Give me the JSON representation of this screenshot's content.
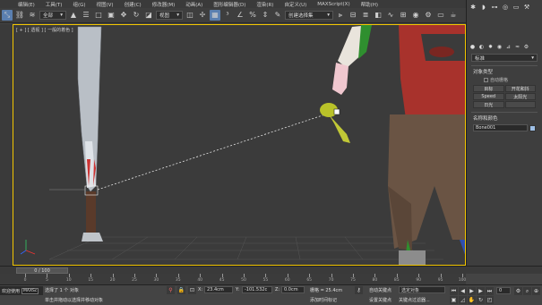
{
  "menu": {
    "items": [
      "编辑(E)",
      "工具(T)",
      "组(G)",
      "视图(V)",
      "创建(C)",
      "修改器(M)",
      "动画(A)",
      "图形编辑器(D)",
      "渲染(R)",
      "自定义(U)",
      "MAXScript(X)",
      "帮助(H)"
    ]
  },
  "toolbar": {
    "selection_filter": "全部",
    "coord_system": "视图",
    "selection_set_placeholder": "创建选择集"
  },
  "viewport": {
    "label": "[ + ] [ 透视 ] [ 一般的着色 ]"
  },
  "command_panel": {
    "category_select": "标准",
    "object_type_title": "对象类型",
    "autogrid_label": "自动栅格",
    "buttons": [
      "目标",
      "开花和抖",
      "Speed",
      "太阳光",
      "日光",
      ""
    ],
    "name_color_title": "名称和颜色",
    "object_name": "Bone001",
    "swatch_color": "#9ec0e6"
  },
  "timeline": {
    "frame_slider": "0 / 100",
    "ticks": [
      "0",
      "5",
      "10",
      "15",
      "20",
      "25",
      "30",
      "35",
      "40",
      "45",
      "50",
      "55",
      "60",
      "65",
      "70",
      "75",
      "80",
      "85",
      "90",
      "95",
      "100"
    ]
  },
  "status": {
    "welcome": "欢迎使用",
    "maxscript": "MAXSc",
    "selection_count": "选择了 1 个 对象",
    "prompt": "单击并拖动以选择并移动对象",
    "x_value": "23.4cm",
    "y_value": "-101.532c",
    "z_value": "0.0cm",
    "grid": "栅格 = 25.4cm",
    "add_time_tag": "添加时间标记",
    "autokey": "自动关键点",
    "set_key": "设置关键点",
    "key_filter_select": "选定对象",
    "key_filters": "关键点过滤器...",
    "frame": "0"
  },
  "accent_colors": {
    "active_tool": "#5a7fb0",
    "viewport_border": "#f2c600",
    "time_slider": "#555555"
  }
}
